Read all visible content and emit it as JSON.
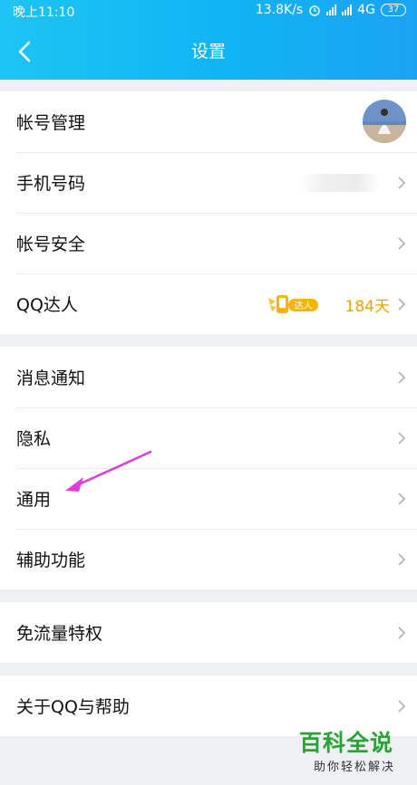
{
  "status_bar": {
    "time": "晚上11:10",
    "speed": "13.8K/s",
    "network": "4G",
    "battery": "37"
  },
  "header": {
    "title": "设置"
  },
  "groups": [
    {
      "rows": [
        {
          "label": "帐号管理"
        },
        {
          "label": "手机号码"
        },
        {
          "label": "帐号安全"
        },
        {
          "label": "QQ达人",
          "badge_text": "达人",
          "days": "184天"
        }
      ]
    },
    {
      "rows": [
        {
          "label": "消息通知"
        },
        {
          "label": "隐私"
        },
        {
          "label": "通用"
        },
        {
          "label": "辅助功能"
        }
      ]
    },
    {
      "rows": [
        {
          "label": "免流量特权"
        }
      ]
    },
    {
      "rows": [
        {
          "label": "关于QQ与帮助"
        }
      ]
    }
  ],
  "annotation": {
    "color": "#e23bdc",
    "points_to": "通用"
  },
  "watermark": {
    "main": "百科全说",
    "sub": "助你轻松解决"
  },
  "colors": {
    "header": "#12b8f4",
    "accent_gold": "#f2a200",
    "watermark_green": "#2aa336"
  }
}
